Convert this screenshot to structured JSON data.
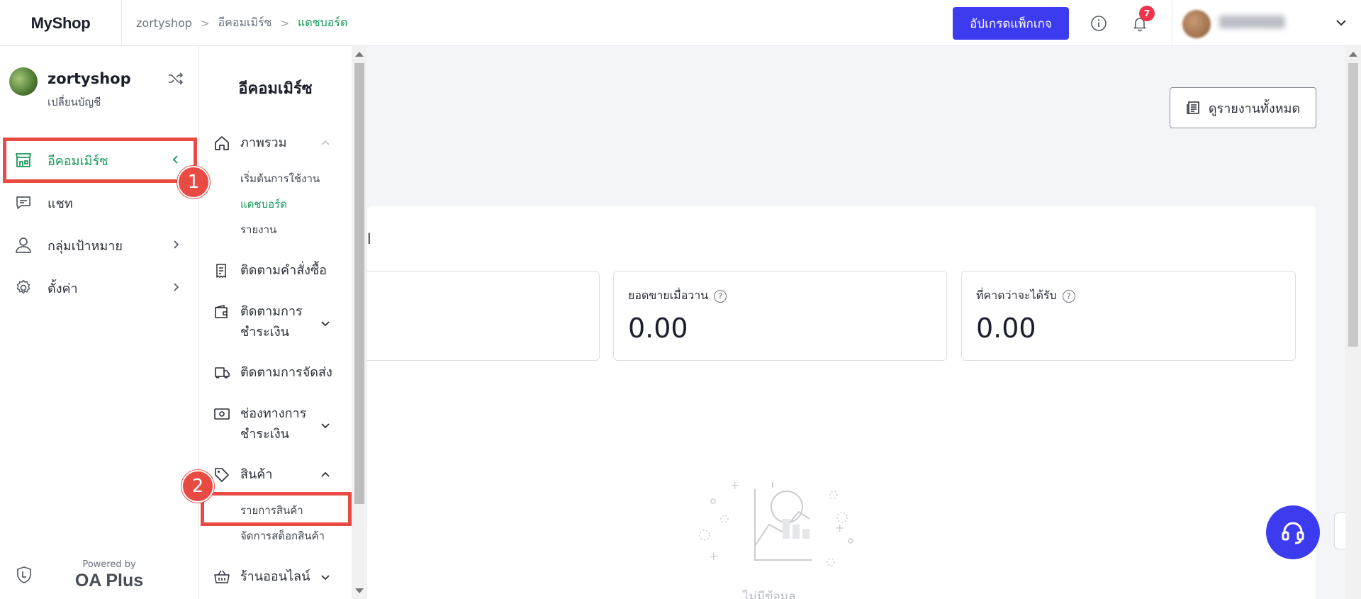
{
  "topbar": {
    "logo": "MyShop",
    "breadcrumb": [
      "zortyshop",
      "อีคอมเมิร์ซ",
      "แดชบอร์ด"
    ],
    "upgrade_label": "อัปเกรดแพ็กเกจ",
    "notification_count": "7"
  },
  "sidebar": {
    "shop_name": "zortyshop",
    "switch_account": "เปลี่ยนบัญชี",
    "items": [
      {
        "label": "อีคอมเมิร์ซ",
        "icon": "store-icon"
      },
      {
        "label": "แชท",
        "icon": "chat-icon"
      },
      {
        "label": "กลุ่มเป้าหมาย",
        "icon": "user-icon"
      },
      {
        "label": "ตั้งค่า",
        "icon": "gear-icon"
      }
    ],
    "powered_by": "Powered by",
    "brand": "OA Plus"
  },
  "submenu": {
    "title": "อีคอมเมิร์ซ",
    "overview": {
      "label": "ภาพรวม",
      "children": [
        "เริ่มต้นการใช้งาน",
        "แดชบอร์ด",
        "รายงาน"
      ]
    },
    "orders": "ติดตามคำสั่งซื้อ",
    "payments": "ติดตามการ\nชำระเงิน",
    "shipping": "ติดตามการจัดส่ง",
    "payment_channels": "ช่องทางการ\nชำระเงิน",
    "products": {
      "label": "สินค้า",
      "children": [
        "รายการสินค้า",
        "จัดการสต็อกสินค้า"
      ]
    },
    "online_store": "ร้านออนไลน์"
  },
  "steps": [
    "1",
    "2"
  ],
  "main": {
    "report_button": "ดูรายงานทั้งหมด",
    "section_title_fragment": "l",
    "stats": [
      {
        "label": "ยอดขายเมื่อวาน",
        "value": "0.00"
      },
      {
        "label": "ที่คาดว่าจะได้รับ",
        "value": "0.00"
      }
    ],
    "empty_text": "ไม่มีข้อมูล"
  },
  "colors": {
    "accent": "#3d3bf0",
    "active_green": "#14995a",
    "highlight_red": "#e94b44",
    "badge_red": "#f0324b"
  }
}
